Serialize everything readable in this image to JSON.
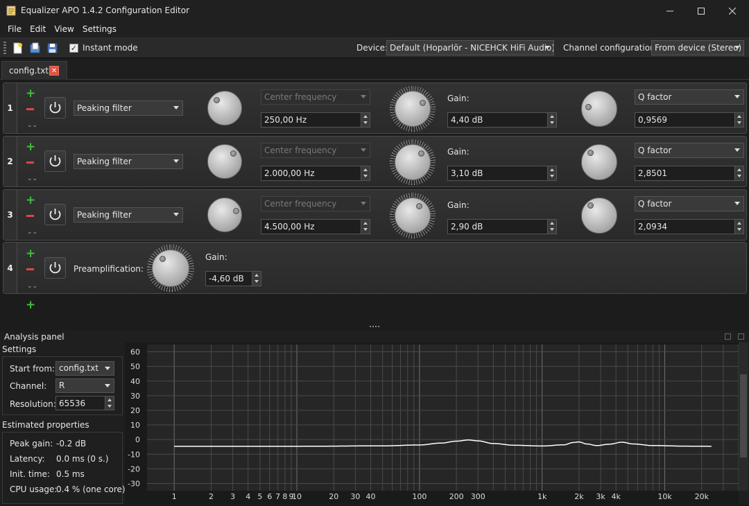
{
  "window": {
    "title": "Equalizer APO 1.4.2 Configuration Editor"
  },
  "menu": [
    "File",
    "Edit",
    "View",
    "Settings"
  ],
  "toolbar": {
    "instant_mode_label": "Instant mode",
    "instant_mode_checked": true,
    "device_label": "Device:",
    "device_value": "Default (Hoparlör - NICEHCK HiFi Audio)",
    "channel_config_label": "Channel configuration:",
    "channel_config_value": "From device (Stereo)"
  },
  "tab": {
    "label": "config.txt"
  },
  "filters": [
    {
      "number": "1",
      "type": "Peaking filter",
      "freq_mode": "Center frequency",
      "freq": "250,00 Hz",
      "gain_label": "Gain:",
      "gain": "4,40 dB",
      "q_mode": "Q factor",
      "q": "0,9569"
    },
    {
      "number": "2",
      "type": "Peaking filter",
      "freq_mode": "Center frequency",
      "freq": "2.000,00 Hz",
      "gain_label": "Gain:",
      "gain": "3,10 dB",
      "q_mode": "Q factor",
      "q": "2,8501"
    },
    {
      "number": "3",
      "type": "Peaking filter",
      "freq_mode": "Center frequency",
      "freq": "4.500,00 Hz",
      "gain_label": "Gain:",
      "gain": "2,90 dB",
      "q_mode": "Q factor",
      "q": "2,0934"
    }
  ],
  "preamp": {
    "number": "4",
    "label": "Preamplification:",
    "gain_label": "Gain:",
    "gain": "-4,60 dB"
  },
  "analysis": {
    "title": "Analysis panel",
    "settings_title": "Settings",
    "start_from_label": "Start from:",
    "start_from": "config.txt",
    "channel_label": "Channel:",
    "channel": "R",
    "resolution_label": "Resolution:",
    "resolution": "65536",
    "props_title": "Estimated properties",
    "peak_gain_label": "Peak gain:",
    "peak_gain": "-0.2 dB",
    "latency_label": "Latency:",
    "latency": "0.0 ms (0 s.)",
    "init_label": "Init. time:",
    "init": "0.5 ms",
    "cpu_label": "CPU usage:",
    "cpu": "0.4 % (one core)"
  },
  "chart_data": {
    "type": "line",
    "y_ticks": [
      "60",
      "50",
      "40",
      "30",
      "20",
      "10",
      "0",
      "-10",
      "-20",
      "-30"
    ],
    "ylim": [
      -35,
      65
    ],
    "x_ticks": [
      "1",
      "2",
      "3",
      "4",
      "5",
      "6",
      "7",
      "8",
      "9",
      "10",
      "20",
      "30",
      "40",
      "100",
      "200",
      "300",
      "1k",
      "2k",
      "3k",
      "4k",
      "10k",
      "20k"
    ],
    "x_tick_values": [
      1,
      2,
      3,
      4,
      5,
      6,
      7,
      8,
      9,
      10,
      20,
      30,
      40,
      100,
      200,
      300,
      1000,
      2000,
      3000,
      4000,
      10000,
      20000
    ],
    "xlim": [
      0.6,
      40000
    ],
    "x_scale": "log",
    "grid": true,
    "series": [
      {
        "color": "#ffffff",
        "x": [
          1,
          10,
          50,
          100,
          150,
          200,
          250,
          300,
          400,
          600,
          1000,
          1500,
          1800,
          2000,
          2300,
          2800,
          3500,
          4500,
          5500,
          8000,
          15000,
          24000
        ],
        "y": [
          -4.6,
          -4.6,
          -4.3,
          -3.7,
          -2.4,
          -1.1,
          -0.3,
          -0.9,
          -2.7,
          -3.9,
          -4.4,
          -3.6,
          -2.0,
          -1.6,
          -3.0,
          -4.1,
          -3.2,
          -1.8,
          -3.0,
          -4.1,
          -4.5,
          -4.6
        ]
      }
    ]
  }
}
